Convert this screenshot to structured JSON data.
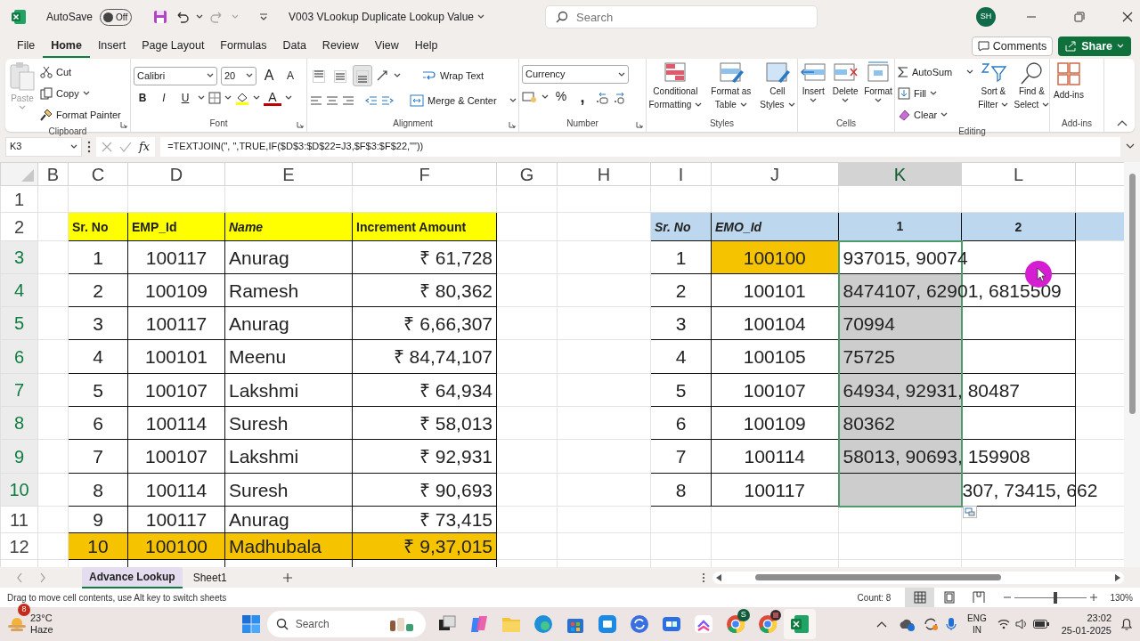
{
  "title_bar": {
    "autosave": {
      "label": "AutoSave",
      "on": false,
      "state_text": "Off"
    },
    "redo_disabled": true,
    "document_title": "V003 VLookup Duplicate Lookup Value",
    "search_placeholder": "Search",
    "account_initials": "SH"
  },
  "menu_tabs": [
    {
      "label": "File",
      "selected": false
    },
    {
      "label": "Home",
      "selected": true
    },
    {
      "label": "Insert",
      "selected": false
    },
    {
      "label": "Page Layout",
      "selected": false
    },
    {
      "label": "Formulas",
      "selected": false
    },
    {
      "label": "Data",
      "selected": false
    },
    {
      "label": "Review",
      "selected": false
    },
    {
      "label": "View",
      "selected": false
    },
    {
      "label": "Help",
      "selected": false
    }
  ],
  "header_buttons": {
    "comments": "Comments",
    "share": "Share"
  },
  "ribbon": {
    "clipboard": {
      "label": "Clipboard",
      "paste": "Paste",
      "paste_disabled": true,
      "cut": "Cut",
      "copy": "Copy",
      "format_painter": "Format Painter"
    },
    "font": {
      "label": "Font",
      "font_name": "Calibri",
      "font_size": "20",
      "grow": "A",
      "shrink": "A",
      "styles": [
        "B",
        "I",
        "U"
      ],
      "font_color": "A"
    },
    "alignment": {
      "label": "Alignment",
      "vertical": [
        {
          "selected": false
        },
        {
          "selected": false
        },
        {
          "selected": true
        }
      ],
      "wrap_text": "Wrap Text",
      "merge_center": "Merge & Center"
    },
    "number": {
      "label": "Number",
      "format": "Currency",
      "percent": "%",
      "comma": ","
    },
    "styles": {
      "label": "Styles",
      "buttons": [
        {
          "lines": [
            "Conditional",
            "Formatting"
          ]
        },
        {
          "lines": [
            "Format as",
            "Table"
          ]
        },
        {
          "lines": [
            "Cell",
            "Styles"
          ]
        }
      ]
    },
    "cells": {
      "label": "Cells",
      "buttons": [
        "Insert",
        "Delete",
        "Format"
      ]
    },
    "editing": {
      "label": "Editing",
      "autosum": "AutoSum",
      "fill": "Fill",
      "clear": "Clear",
      "sort": [
        "Sort &",
        "Filter"
      ],
      "find": [
        "Find &",
        "Select"
      ]
    },
    "addins": {
      "label": "Add-ins",
      "button": "Add-ins"
    }
  },
  "formula_bar": {
    "name_box": "K3",
    "fx": "fx",
    "formula": "=TEXTJOIN(\", \",TRUE,IF($D$3:$D$22=J3,$F$3:$F$22,\"\"))"
  },
  "column_headers": [
    {
      "label": "B",
      "selected": false
    },
    {
      "label": "C",
      "selected": false
    },
    {
      "label": "D",
      "selected": false
    },
    {
      "label": "E",
      "selected": false
    },
    {
      "label": "F",
      "selected": false
    },
    {
      "label": "G",
      "selected": false
    },
    {
      "label": "H",
      "selected": false
    },
    {
      "label": "I",
      "selected": false
    },
    {
      "label": "J",
      "selected": false
    },
    {
      "label": "K",
      "selected": true
    },
    {
      "label": "L",
      "selected": false
    }
  ],
  "row_headers": [
    {
      "label": "1",
      "selected": false
    },
    {
      "label": "2",
      "selected": false
    },
    {
      "label": "3",
      "selected": true
    },
    {
      "label": "4",
      "selected": true
    },
    {
      "label": "5",
      "selected": true
    },
    {
      "label": "6",
      "selected": true
    },
    {
      "label": "7",
      "selected": true
    },
    {
      "label": "8",
      "selected": true
    },
    {
      "label": "9",
      "selected": true
    },
    {
      "label": "10",
      "selected": true
    },
    {
      "label": "11",
      "selected": false
    },
    {
      "label": "12",
      "selected": false
    }
  ],
  "left_table": {
    "columns": [
      {
        "label": "Sr. No",
        "italic": false
      },
      {
        "label": "EMP_Id",
        "italic": false
      },
      {
        "label": "Name",
        "italic": true
      },
      {
        "label": "Increment Amount",
        "italic": false
      }
    ],
    "rows": [
      {
        "cells": [
          "1",
          "100117",
          "Anurag",
          "₹ 61,728"
        ],
        "highlight": false
      },
      {
        "cells": [
          "2",
          "100109",
          "Ramesh",
          "₹ 80,362"
        ],
        "highlight": false
      },
      {
        "cells": [
          "3",
          "100117",
          "Anurag",
          "₹ 6,66,307"
        ],
        "highlight": false
      },
      {
        "cells": [
          "4",
          "100101",
          "Meenu",
          "₹ 84,74,107"
        ],
        "highlight": false
      },
      {
        "cells": [
          "5",
          "100107",
          "Lakshmi",
          "₹ 64,934"
        ],
        "highlight": false
      },
      {
        "cells": [
          "6",
          "100114",
          "Suresh",
          "₹ 58,013"
        ],
        "highlight": false
      },
      {
        "cells": [
          "7",
          "100107",
          "Lakshmi",
          "₹ 92,931"
        ],
        "highlight": false
      },
      {
        "cells": [
          "8",
          "100114",
          "Suresh",
          "₹ 90,693"
        ],
        "highlight": false
      },
      {
        "cells": [
          "9",
          "100117",
          "Anurag",
          "₹ 73,415"
        ],
        "highlight": false
      },
      {
        "cells": [
          "10",
          "100100",
          "Madhubala",
          "₹ 9,37,015"
        ],
        "highlight": true
      }
    ]
  },
  "right_table": {
    "columns": [
      {
        "label": "Sr. No",
        "italic": true
      },
      {
        "label": "EMO_Id",
        "italic": true
      },
      {
        "label": "1",
        "italic": false
      },
      {
        "label": "2",
        "italic": false
      }
    ],
    "rows": [
      {
        "sr": "1",
        "emp_id": "100100",
        "highlight": true,
        "active": true,
        "result": "937015, 90074"
      },
      {
        "sr": "2",
        "emp_id": "100101",
        "highlight": false,
        "active": false,
        "result": "8474107, 62901, 6815509"
      },
      {
        "sr": "3",
        "emp_id": "100104",
        "highlight": false,
        "active": false,
        "result": "70994"
      },
      {
        "sr": "4",
        "emp_id": "100105",
        "highlight": false,
        "active": false,
        "result": "75725"
      },
      {
        "sr": "5",
        "emp_id": "100107",
        "highlight": false,
        "active": false,
        "result": "64934, 92931, 80487"
      },
      {
        "sr": "6",
        "emp_id": "100109",
        "highlight": false,
        "active": false,
        "result": "80362"
      },
      {
        "sr": "7",
        "emp_id": "100114",
        "highlight": false,
        "active": false,
        "result": "58013, 90693, 159908"
      },
      {
        "sr": "8",
        "emp_id": "100117",
        "highlight": false,
        "active": false,
        "spill": "307, 73415, 662"
      }
    ]
  },
  "sheet_tabs": [
    {
      "label": "Advance Lookup",
      "selected": true
    },
    {
      "label": "Sheet1",
      "selected": false
    }
  ],
  "status_bar": {
    "message": "Drag to move cell contents, use Alt key to switch sheets",
    "count": "Count: 8",
    "views": [
      {
        "kind": "normal",
        "selected": true
      },
      {
        "kind": "page_layout",
        "selected": false
      },
      {
        "kind": "page_break",
        "selected": false
      }
    ],
    "zoom": {
      "level": 0.56,
      "text": "130%"
    }
  },
  "taskbar": {
    "weather": {
      "badge": "8",
      "temperature": "23°C",
      "condition": "Haze"
    },
    "search_placeholder": "Search",
    "chrome_badge": "S",
    "language": [
      "ENG",
      "IN"
    ],
    "time": "23:02",
    "date": "25-01-2025"
  }
}
